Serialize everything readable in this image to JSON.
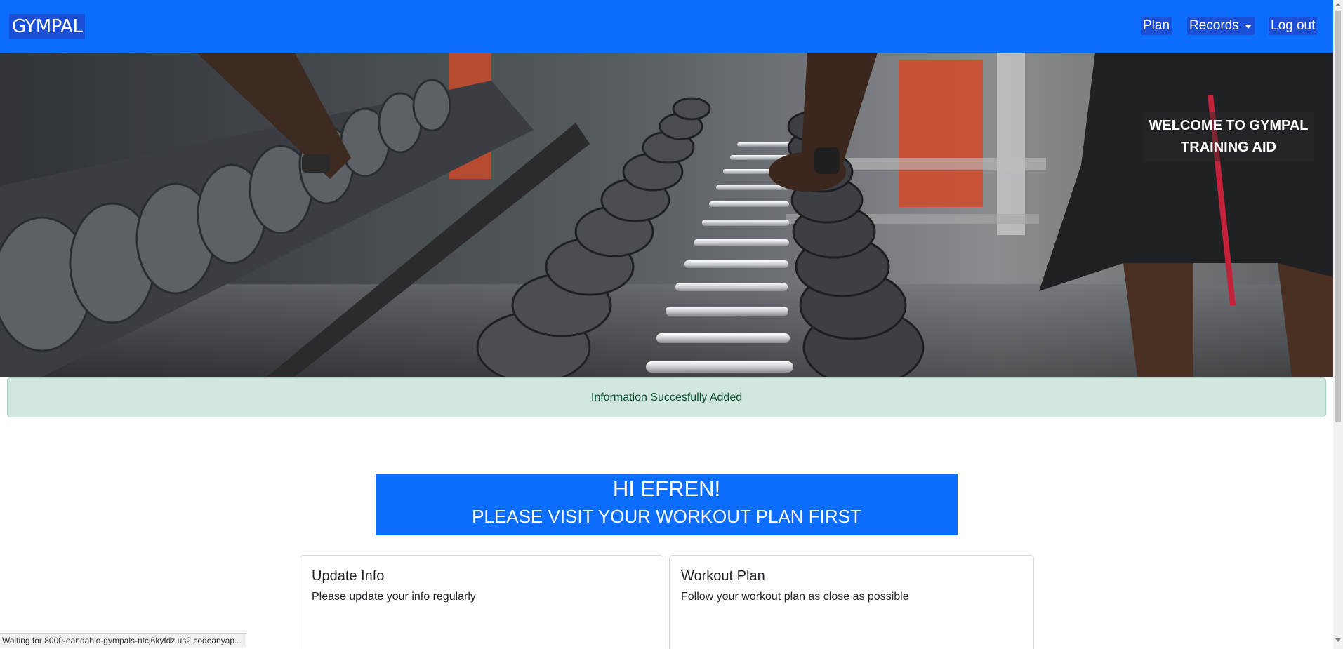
{
  "navbar": {
    "brand": "GYMPAL",
    "links": {
      "plan": "Plan",
      "records": "Records",
      "logout": "Log out"
    }
  },
  "hero": {
    "welcome_line1": "WELCOME TO GYMPAL",
    "welcome_line2": "TRAINING AID"
  },
  "alert": {
    "message": "Information Succesfully Added"
  },
  "greeting": {
    "hi": "HI EFREN!",
    "message": "PLEASE VISIT YOUR WORKOUT PLAN FIRST"
  },
  "cards": [
    {
      "title": "Update Info",
      "text": "Please update your info regularly"
    },
    {
      "title": "Workout Plan",
      "text": "Follow your workout plan as close as possible"
    }
  ],
  "status_bar": {
    "text": "Waiting for 8000-eandablo-gympals-ntcj6kyfdz.us2.codeanyap..."
  },
  "colors": {
    "primary": "#0d6efd",
    "alert_bg": "#d1e7dd",
    "alert_text": "#0f5132"
  }
}
